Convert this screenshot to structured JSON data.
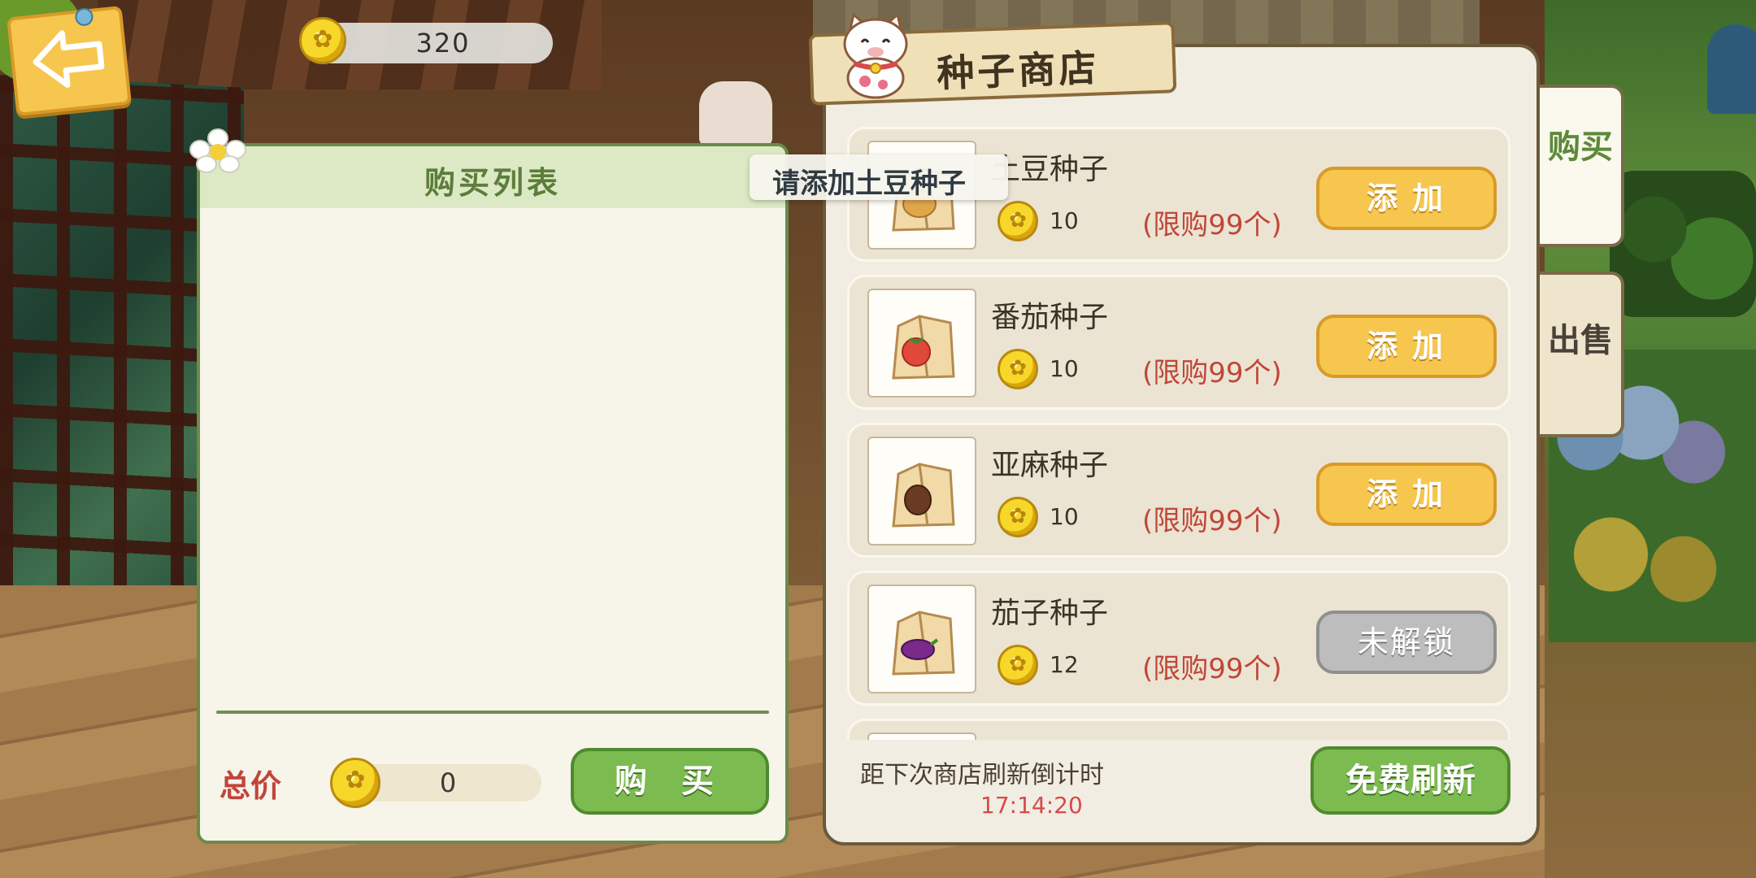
{
  "top_bar": {
    "coins": "320"
  },
  "purchase_list": {
    "title": "购买列表",
    "total_label": "总价",
    "total_value": "0",
    "buy_label": "购 买"
  },
  "shop": {
    "title": "种子商店",
    "tabs": [
      {
        "label": "购买",
        "active": true
      },
      {
        "label": "出售",
        "active": false
      }
    ],
    "tooltip": "请添加土豆种子",
    "items": [
      {
        "name": "土豆种子",
        "price": "10",
        "limit": "(限购99个)",
        "button": "添加",
        "status": "available",
        "icon": "potato-seed-bag-icon"
      },
      {
        "name": "番茄种子",
        "price": "10",
        "limit": "(限购99个)",
        "button": "添加",
        "status": "available",
        "icon": "tomato-seed-bag-icon"
      },
      {
        "name": "亚麻种子",
        "price": "10",
        "limit": "(限购99个)",
        "button": "添加",
        "status": "available",
        "icon": "flax-seed-bag-icon"
      },
      {
        "name": "茄子种子",
        "price": "12",
        "limit": "(限购99个)",
        "button": "未解锁",
        "status": "locked",
        "icon": "eggplant-seed-bag-icon"
      }
    ],
    "refresh_label": "距下次商店刷新倒计时",
    "refresh_timer": "17:14:20",
    "refresh_button": "免费刷新"
  },
  "colors": {
    "accent_green": "#7cbb4f",
    "accent_yellow": "#f6c64e",
    "limit_red": "#c0463a",
    "timer_red": "#d64a4a",
    "locked_gray": "#bdbdbd"
  }
}
